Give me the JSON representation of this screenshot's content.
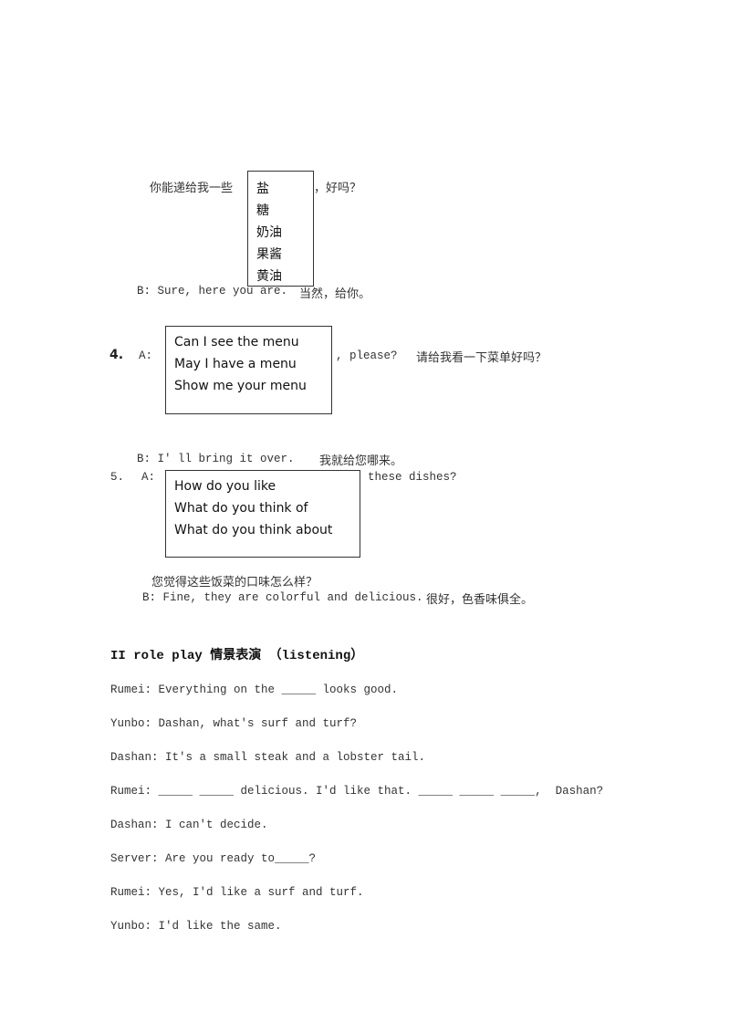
{
  "item3": {
    "prompt_cn": "你能递给我一些",
    "options": [
      "盐",
      "糖",
      "奶油",
      "果酱",
      "黄油"
    ],
    "suffix_cn": "，好吗？",
    "answer_en": "B: Sure, here you are.",
    "answer_cn": "当然，给你。"
  },
  "item4": {
    "number": "4.",
    "speaker": "A:",
    "options": [
      "Can I see the menu",
      "May I have a menu",
      "Show me your menu"
    ],
    "suffix_en": ", please?",
    "translation_cn": "请给我看一下菜单好吗？",
    "answer_en": "B: I' ll bring it over.",
    "answer_cn": "我就给您哪来。"
  },
  "item5": {
    "number": "5.",
    "speaker": "A:",
    "options": [
      "How do you like",
      "What do you think of",
      "What do you think about"
    ],
    "suffix_en": "these dishes?",
    "translation_cn": "您觉得这些饭菜的口味怎么样？",
    "answer_en": "B: Fine, they are colorful and delicious.",
    "answer_cn": "很好，色香味俱全。"
  },
  "section2": {
    "heading": "II role play 情景表演 （listening）",
    "lines": [
      "Rumei: Everything on the _____ looks good.",
      "Yunbo: Dashan, what's surf and turf?",
      "Dashan: It's a small steak and a lobster tail.",
      "Rumei: _____ _____ delicious. I'd like that. _____ _____ _____,  Dashan?",
      "Dashan: I can't decide.",
      "Server: Are you ready to_____?",
      "Rumei: Yes, I'd like a surf and turf.",
      "Yunbo: I'd like the same."
    ]
  }
}
